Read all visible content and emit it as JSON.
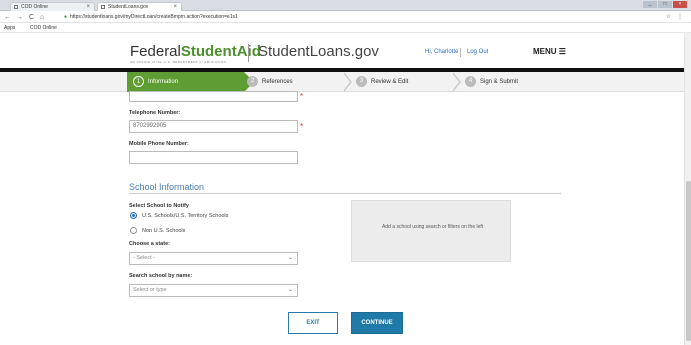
{
  "browser": {
    "tabs": [
      {
        "label": "COD Online",
        "close": "×"
      },
      {
        "label": "StudentLoans.gov",
        "close": "×"
      }
    ],
    "window_controls": [
      "_",
      "□",
      "×"
    ],
    "nav": {
      "back": "←",
      "forward": "→",
      "reload": "C",
      "home": "⌂"
    },
    "url": "https://studentloans.gov/myDirectLoan/createBmprn.action?execution=e1s1",
    "lock": "●",
    "star": "☆",
    "menu": "⋮",
    "bookmarks": [
      {
        "label": "Apps"
      },
      {
        "label": "COD Online"
      }
    ]
  },
  "header": {
    "fsa_plain": "Federal",
    "fsa_bold": "Student",
    "fsa_aid": "Aid",
    "fsa_sub": "AN OFFICE of the U.S. DEPARTMENT of EDUCATION",
    "site_name": "StudentLoans.gov",
    "greeting": "Hi, Charlotte",
    "logout": "Log Out",
    "menu": "MENU ☰"
  },
  "steps": [
    {
      "num": "1",
      "label": "Information"
    },
    {
      "num": "2",
      "label": "References"
    },
    {
      "num": "3",
      "label": "Review & Edit"
    },
    {
      "num": "4",
      "label": "Sign & Submit"
    }
  ],
  "form": {
    "required_mark": "*",
    "telephone_label": "Telephone Number:",
    "telephone_value": "8702992905",
    "mobile_label": "Mobile Phone Number:",
    "mobile_value": "",
    "section_title": "School Information",
    "select_school_label": "Select School to Notify",
    "radio_us": "U.S. Schools/U.S. Territory Schools",
    "radio_non_us": "Non U.S. Schools",
    "state_label": "Choose a state:",
    "state_value": "- Select -",
    "search_label": "Search school by name:",
    "search_placeholder": "Select or type",
    "school_box_text": "Add a school using search or filters on the left",
    "caret": "⌄"
  },
  "buttons": {
    "exit": "EXIT",
    "continue": "CONTINUE"
  }
}
